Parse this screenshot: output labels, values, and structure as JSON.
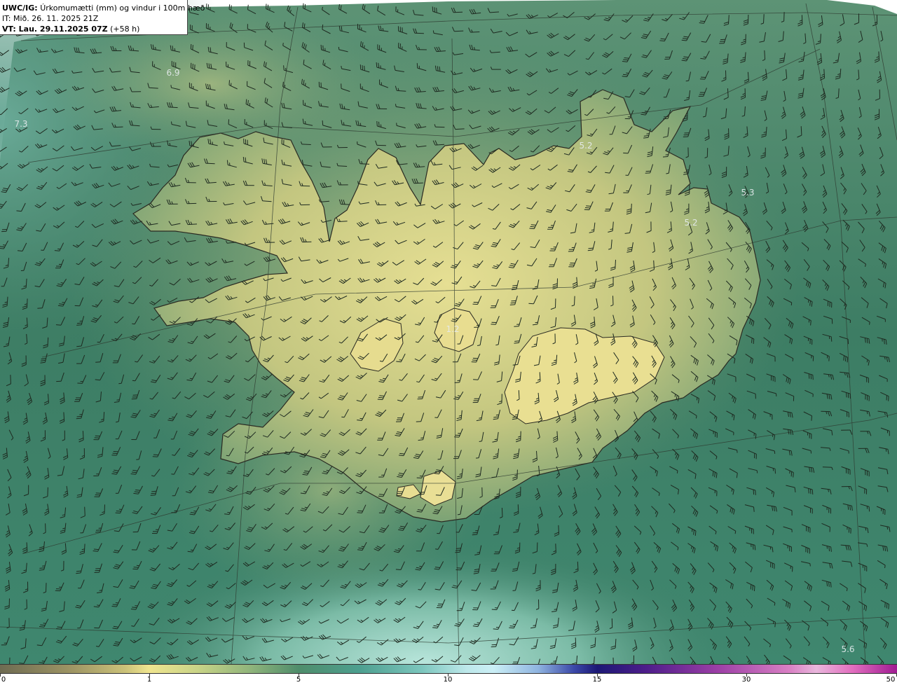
{
  "header": {
    "model_label": "UWC/IG:",
    "title": "Úrkomumætti (mm) og vindur i 100m hæð",
    "issue_time": "IT: Mið. 26. 11. 2025 21Z",
    "valid_label": "VT: Lau. 29.11.2025 07Z",
    "lead_time": "(+58 h)"
  },
  "map_labels": [
    "6.9",
    "7.3",
    "5.2",
    "5.3",
    "5.2",
    "1.2",
    "5.6"
  ],
  "colorbar": {
    "ticks": [
      "0",
      "1",
      "5",
      "10",
      "15",
      "30",
      "50"
    ],
    "colors": {
      "low": "#6e6b52",
      "one": "#f0e58f",
      "five": "#4f8d6b",
      "ten": "#cbeff6",
      "fifteen": "#1c1875",
      "thirty": "#e9b6dc",
      "fifty": "#a01b92"
    }
  },
  "colors": {
    "land_fill": "#d2cc84",
    "sea_fill": "#3f7f66",
    "coast_line": "#2a2a22",
    "wind_barb": "#1e2a20"
  },
  "icons": {
    "wind_barb": "wind-barb-icon"
  }
}
